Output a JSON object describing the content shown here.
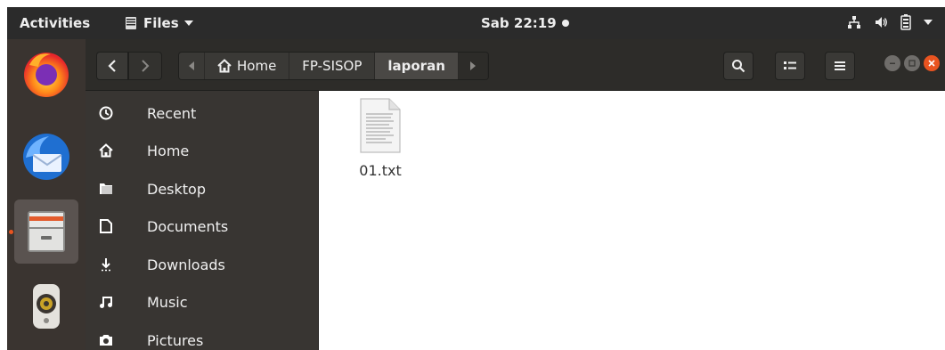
{
  "topbar": {
    "activities": "Activities",
    "app_menu": "Files",
    "clock": "Sab 22:19"
  },
  "dock": {
    "items": [
      "firefox",
      "thunderbird",
      "files",
      "rhythmbox"
    ],
    "active_item": "files",
    "accent": "#e95420"
  },
  "toolbar": {
    "back": "‹",
    "forward": "›",
    "path": [
      "Home",
      "FP-SISOP",
      "laporan"
    ],
    "current": "laporan"
  },
  "sidebar": {
    "items": [
      {
        "label": "Recent",
        "icon": "clock-icon"
      },
      {
        "label": "Home",
        "icon": "home-icon"
      },
      {
        "label": "Desktop",
        "icon": "folder-icon"
      },
      {
        "label": "Documents",
        "icon": "document-icon"
      },
      {
        "label": "Downloads",
        "icon": "download-icon"
      },
      {
        "label": "Music",
        "icon": "music-icon"
      },
      {
        "label": "Pictures",
        "icon": "camera-icon"
      }
    ]
  },
  "files": [
    {
      "name": "01.txt",
      "icon": "text-file-icon"
    }
  ],
  "colors": {
    "panel": "#2b2b2b",
    "sidebar": "#383532",
    "headerbar": "#2d2c29",
    "close": "#e95420"
  }
}
